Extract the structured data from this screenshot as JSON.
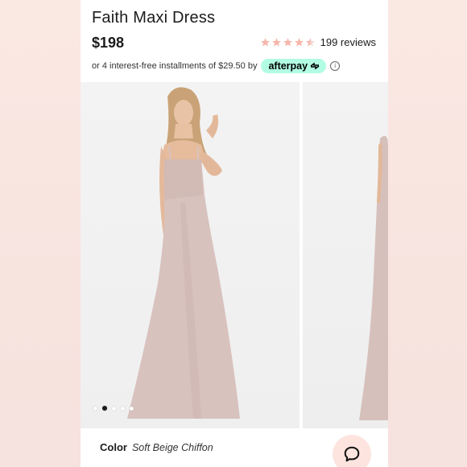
{
  "product": {
    "title": "Faith Maxi Dress",
    "price": "$198",
    "rating_value": 4.5,
    "reviews_label": "199 reviews"
  },
  "installments": {
    "text": "or 4 interest-free installments of $29.50 by",
    "provider": "afterpay",
    "info_icon": "info-icon"
  },
  "gallery": {
    "image_count": 5,
    "active_index": 1
  },
  "color": {
    "label": "Color",
    "value": "Soft Beige Chiffon"
  },
  "colors": {
    "star": "#f6b7ac",
    "afterpay_bg": "#b2fce4",
    "chat_bg": "#fde4df",
    "dress": "#d8c2be"
  },
  "icons": {
    "chat": "chat-bubble-icon",
    "star": "star-icon"
  }
}
